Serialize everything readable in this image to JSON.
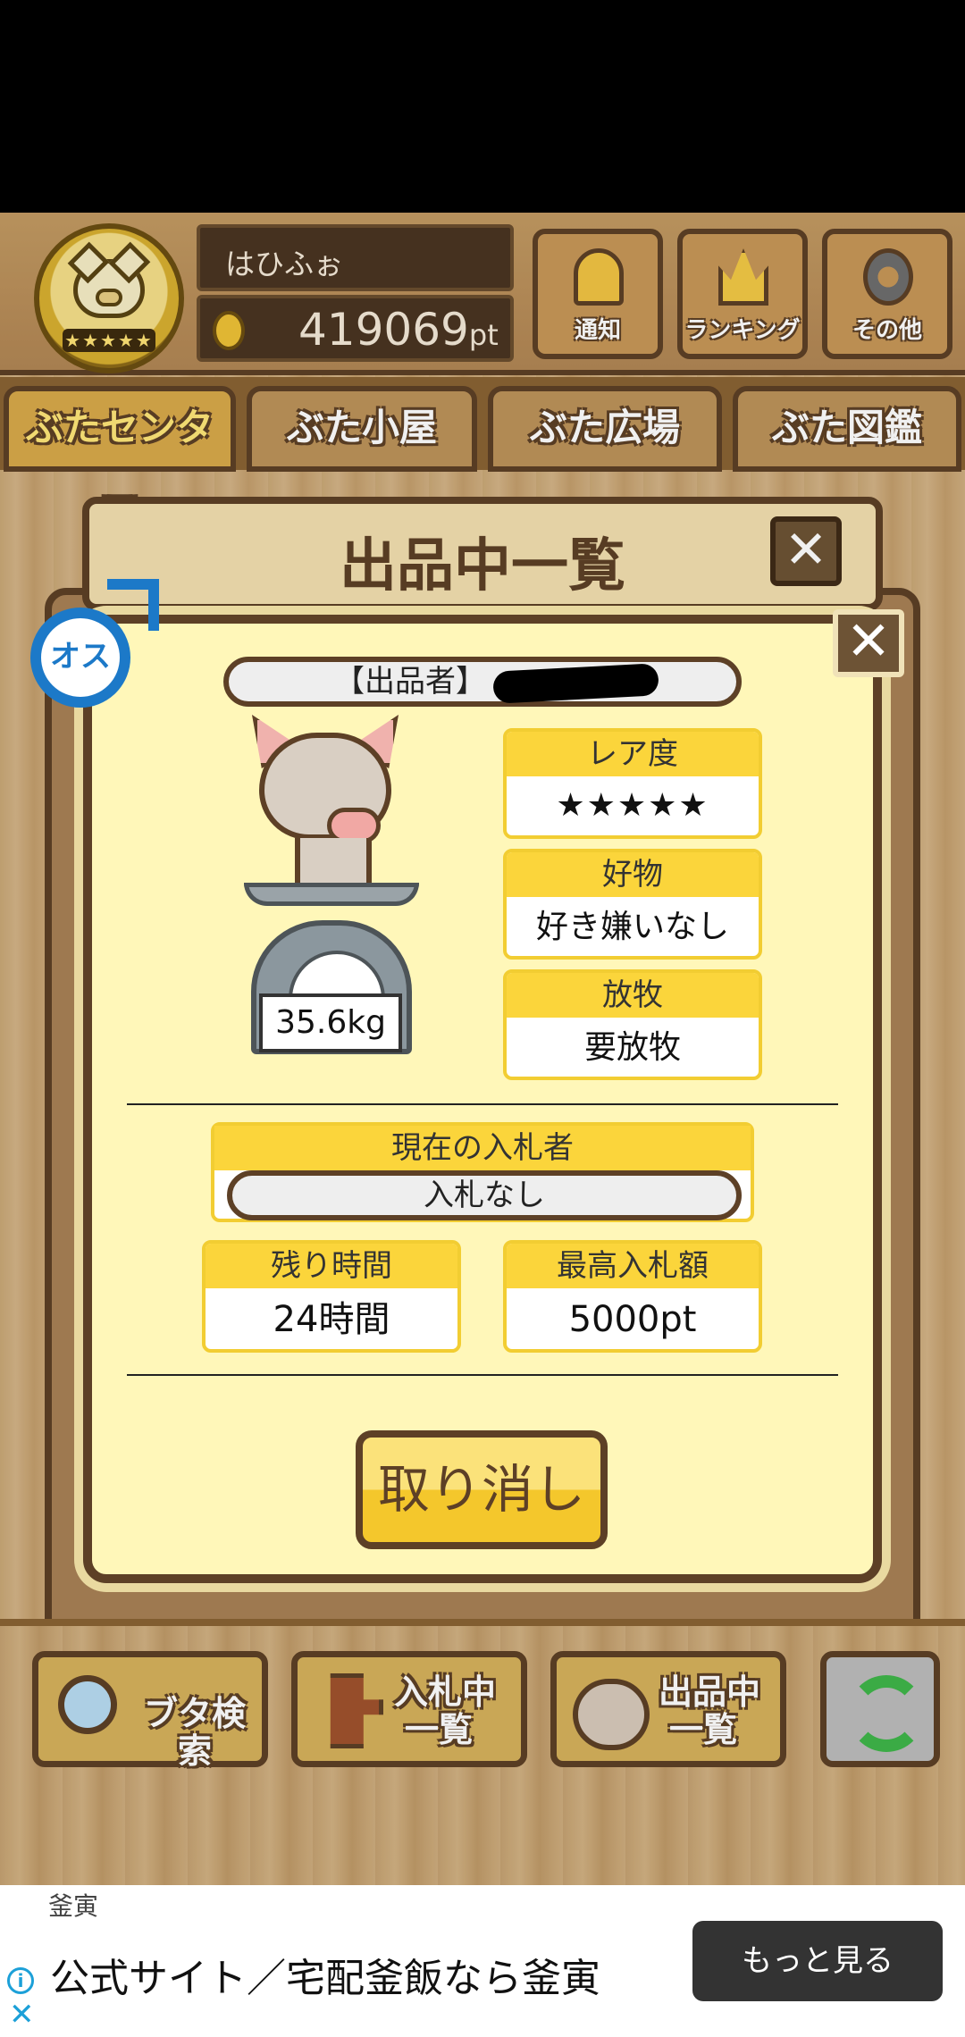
{
  "header": {
    "rank_stars": "★★★★★",
    "username": "はひふぉ",
    "points_value": "419069",
    "points_unit": "pt",
    "buttons": {
      "notify": "通知",
      "ranking": "ランキング",
      "other": "その他"
    }
  },
  "tabs": [
    {
      "label": "ぶたセンター",
      "active": true
    },
    {
      "label": "ぶた小屋"
    },
    {
      "label": "ぶた広場"
    },
    {
      "label": "ぶた図鑑"
    }
  ],
  "background_dialog": {
    "title": "出品中一覧",
    "close_glyph": "✕"
  },
  "modal": {
    "close_glyph": "✕",
    "gender": "オス",
    "seller_label": "【出品者】",
    "weight": "35.6kg",
    "rarity": {
      "label": "レア度",
      "stars": "★★★★★"
    },
    "favorite": {
      "label": "好物",
      "value": "好き嫌いなし"
    },
    "grazing": {
      "label": "放牧",
      "value": "要放牧"
    },
    "current_bidder": {
      "label": "現在の入札者",
      "value": "入札なし"
    },
    "time_left": {
      "label": "残り時間",
      "value": "24時間"
    },
    "max_bid": {
      "label": "最高入札額",
      "value": "5000pt"
    },
    "cancel_button": "取り消し"
  },
  "bottom_bar": {
    "search": "ブタ検索",
    "bidding_line1": "入札中",
    "bidding_line2": "一覧",
    "listing_line1": "出品中",
    "listing_line2": "一覧"
  },
  "ad": {
    "brand": "釜寅",
    "headline": "公式サイト／宅配釜飯なら釜寅",
    "more_button": "もっと見る",
    "info_glyph": "i",
    "close_glyph": "✕"
  }
}
